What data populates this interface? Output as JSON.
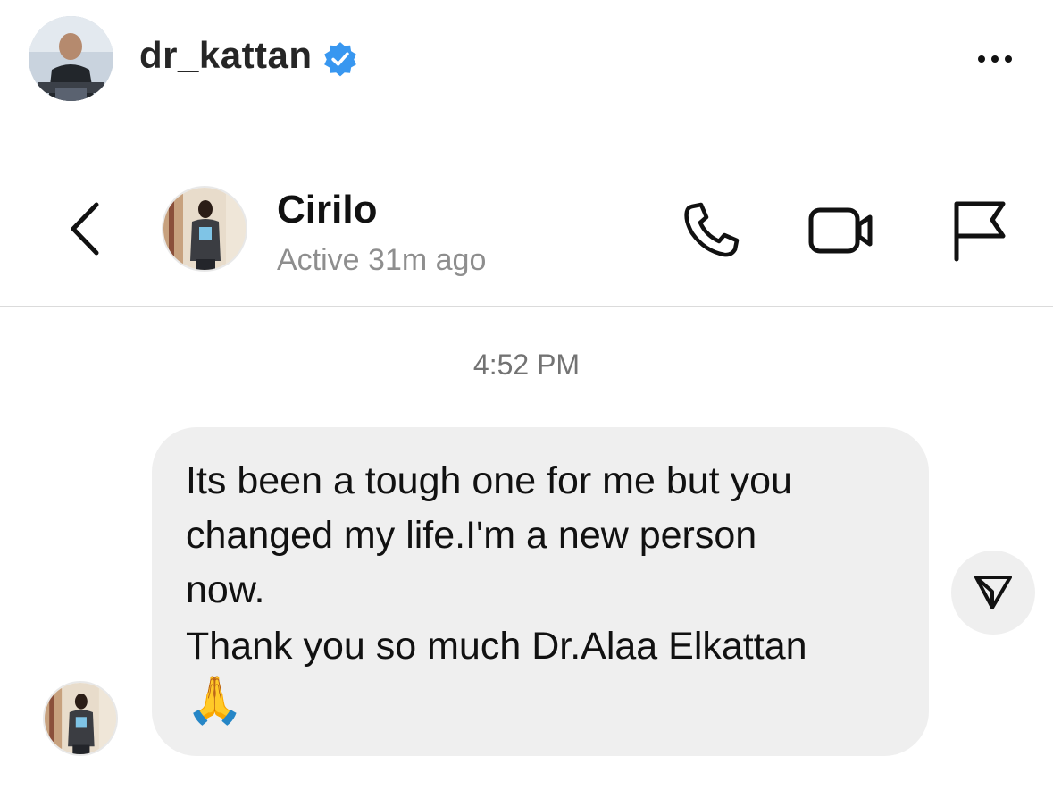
{
  "post_header": {
    "username": "dr_kattan",
    "verified": true,
    "verified_badge_color": "#3897f0",
    "more_icon": "more-horizontal-icon"
  },
  "chat_header": {
    "back_icon": "chevron-left-icon",
    "contact_name": "Cirilo",
    "contact_status": "Active 31m ago",
    "actions": {
      "call_icon": "phone-icon",
      "video_icon": "video-camera-icon",
      "report_icon": "flag-icon"
    }
  },
  "conversation": {
    "timestamp": "4:52 PM",
    "message": {
      "text_line1": "Its been a tough one for me but you\nchanged my life.I'm a new person\nnow.",
      "text_line2": "Thank you so much Dr.Alaa Elkattan",
      "emoji": "🙏",
      "bubble_color": "#efefef"
    },
    "share_icon": "send-icon"
  }
}
